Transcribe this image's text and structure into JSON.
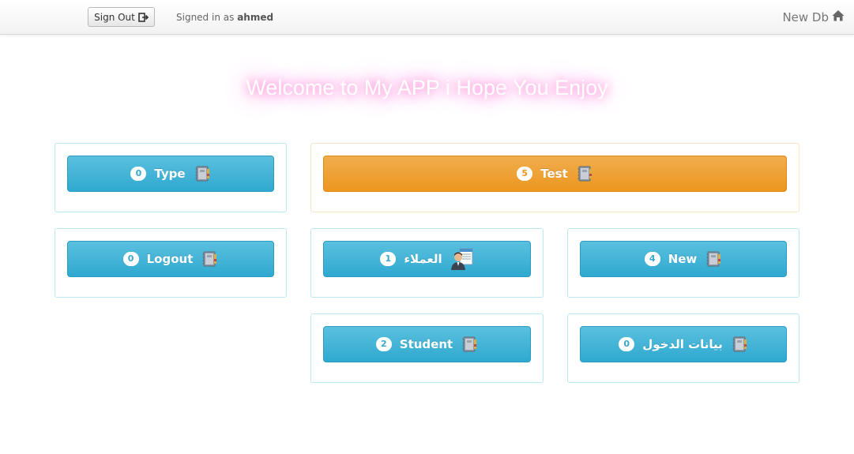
{
  "header": {
    "signout_label": "Sign Out",
    "signed_in_prefix": "Signed in as",
    "username": "ahmed",
    "brand": "New Db"
  },
  "welcome": "Welcome to My APP i Hope You Enjoy",
  "tiles": [
    {
      "label": "Type",
      "count": "0",
      "icon": "notebook-icon",
      "color": "#5bc0de"
    },
    {
      "label": "Test",
      "count": "5",
      "icon": "notebook-icon",
      "color": "#f0ad4e"
    },
    {
      "label": "Logout",
      "count": "0",
      "icon": "notebook-icon",
      "color": "#5bc0de"
    },
    {
      "label": "العملاء",
      "count": "1",
      "icon": "client-person-icon",
      "color": "#5bc0de"
    },
    {
      "label": "New",
      "count": "4",
      "icon": "notebook-icon",
      "color": "#5bc0de"
    },
    {
      "label": "Student",
      "count": "2",
      "icon": "notebook-icon",
      "color": "#5bc0de"
    },
    {
      "label": "بيانات الدخول",
      "count": "0",
      "icon": "notebook-icon",
      "color": "#5bc0de"
    }
  ]
}
